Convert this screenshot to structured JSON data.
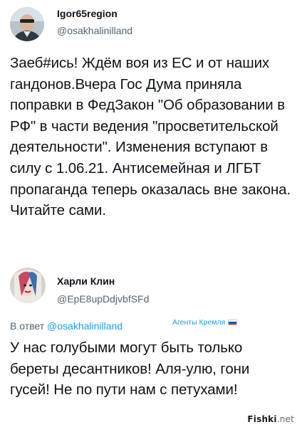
{
  "tweet_main": {
    "display_name": "Igor65region",
    "handle": "@osakhalinilland",
    "text": "Заеб#ись! Ждём воя из ЕС и от наших гандонов.Вчера Гос Дума приняла поправки в ФедЗакон \"Об образовании в РФ\" в части ведения \"просветительской деятельности\". Изменения вступают в силу с 1.06.21. Антисемейная и ЛГБТ пропаганда теперь оказалась вне закона. Читайте сами."
  },
  "tweet_reply": {
    "display_name": "Харли Клин",
    "handle": "@EpE8upDdjvbfSFd",
    "reply_prefix": "В ответ",
    "reply_to": "@osakhalinilland",
    "badge_label": "Агенты Кремля",
    "text": "У нас голубыми могут быть только береты десантников! Аля-улю, гони гусей! Не по пути нам с петухами!"
  },
  "watermark": {
    "brand": "Fishki",
    "suffix": ".net"
  },
  "colors": {
    "text": "#0f1419",
    "secondary": "#536471",
    "link": "#1d9bf0"
  }
}
